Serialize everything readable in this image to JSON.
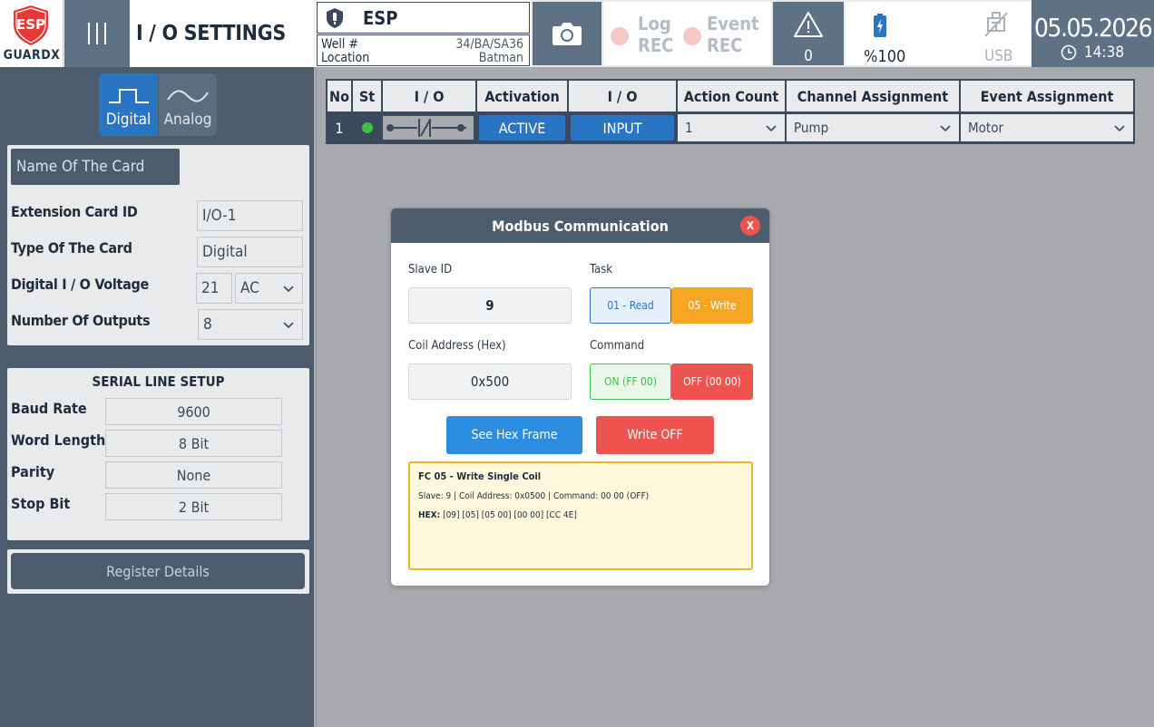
{
  "header": {
    "logo_badge": "ESP",
    "logo_brand": "GUARDX",
    "page_title": "I / O SETTINGS",
    "well": {
      "name": "ESP",
      "well_label": "Well #",
      "well_value": "34/BA/SA36",
      "location_label": "Location",
      "location_value": "Batman"
    },
    "log_rec": [
      "Log",
      "REC"
    ],
    "event_rec": [
      "Event",
      "REC"
    ],
    "alarm_count": "0",
    "battery": "%100",
    "usb": "USB",
    "date": "05.05.2026",
    "time": "14:38",
    "colors": {
      "accent": "#5f7184",
      "rec_dot": "#f6c7c7",
      "logo_red": "#e53935"
    }
  },
  "sidebar": {
    "type_toggle": {
      "digital": "Digital",
      "analog": "Analog",
      "active": "Digital"
    },
    "card_name_button": "Name Of The Card",
    "fields": {
      "ext_id_label": "Extension Card ID",
      "ext_id_value": "I/O-1",
      "type_label": "Type Of The Card",
      "type_value": "Digital",
      "voltage_label": "Digital I / O Voltage",
      "voltage_value": "21",
      "voltage_type": "AC",
      "outputs_label": "Number Of Outputs",
      "outputs_value": "8"
    },
    "serial": {
      "title": "SERIAL LINE SETUP",
      "baud_label": "Baud Rate",
      "baud_value": "9600",
      "word_label": "Word Length",
      "word_value": "8 Bit",
      "parity_label": "Parity",
      "parity_value": "None",
      "stop_label": "Stop Bit",
      "stop_value": "2 Bit"
    },
    "register_button": "Register Details"
  },
  "table": {
    "headers": [
      "No",
      "St",
      "I / O",
      "Activation",
      "I / O",
      "Action Count",
      "Channel Assignment",
      "Event Assignment"
    ],
    "rows": [
      {
        "no": "1",
        "status": "on",
        "activation": "ACTIVE",
        "io_type": "INPUT",
        "action_count": "1",
        "channel": "Pump",
        "event": "Motor"
      }
    ]
  },
  "modal": {
    "title": "Modbus Communication",
    "close": "X",
    "slave_label": "Slave ID",
    "slave_value": "9",
    "task_label": "Task",
    "task_read": "01 - Read",
    "task_write": "05 - Write",
    "coil_label": "Coil Address (Hex)",
    "coil_value": "0x500",
    "command_label": "Command",
    "cmd_on": "ON  (FF 00)",
    "cmd_off": "OFF (00 00)",
    "see_hex_button": "See Hex Frame",
    "write_button": "Write OFF",
    "hex_title": "FC 05 - Write Single Coil",
    "hex_summary": "Slave: 9 | Coil Address: 0x0500 | Command: 00 00 (OFF)",
    "hex_label": "HEX:",
    "hex_frame": "[09] [05] [05 00] [00 00] [CC 4E]",
    "colors": {
      "blue": "#2a74c4",
      "orange": "#f5a623",
      "red": "#ef5350",
      "green": "#3ec04a"
    }
  }
}
